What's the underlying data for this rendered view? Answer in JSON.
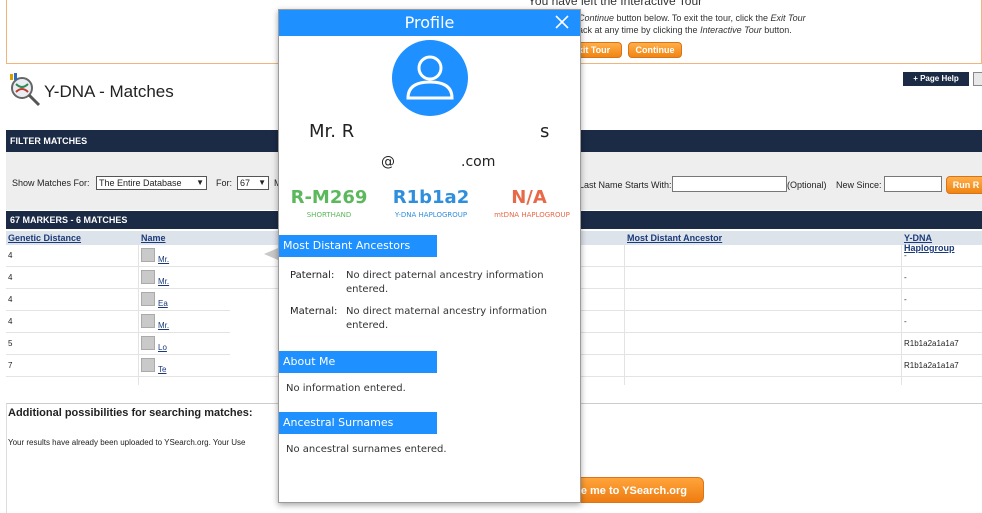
{
  "tour": {
    "title": "You have left the Interactive Tour",
    "line1_prefix": "",
    "line1_em": "Continue",
    "line1_rest": " button below. To exit the tour, click the ",
    "line1_em2": "Exit Tour",
    "line2_prefix": "ack at any time by clicking the ",
    "line2_em": "Interactive Tour",
    "line2_rest": " button.",
    "exit_label": "Exit Tour",
    "continue_label": "Continue"
  },
  "header": {
    "title": "Y-DNA - Matches",
    "page_help_label": "+ Page Help"
  },
  "filter": {
    "bar_title": "FILTER MATCHES",
    "show_for_label": "Show Matches For:",
    "show_for_value": "The Entire Database",
    "for_label": "For:",
    "for_value": "67",
    "for_more": "M",
    "last_name_label": "Last Name Starts With:",
    "optional": "(Optional)",
    "new_since_label": "New Since:",
    "run_label": "Run R"
  },
  "table": {
    "bar_title": "67 MARKERS - 6 MATCHES",
    "headers": {
      "distance": "Genetic Distance",
      "name": "Name",
      "ancestor": "Most Distant Ancestor",
      "haplogroup": "Y-DNA Haplogroup"
    },
    "rows": [
      {
        "distance": "4",
        "name": "Mr.",
        "haplogroup": "-"
      },
      {
        "distance": "4",
        "name": "Mr.",
        "haplogroup": "-"
      },
      {
        "distance": "4",
        "name": "Ea",
        "haplogroup": "-"
      },
      {
        "distance": "4",
        "name": "Mr.",
        "haplogroup": "-"
      },
      {
        "distance": "5",
        "name": "Lo",
        "haplogroup": "R1b1a2a1a1a7"
      },
      {
        "distance": "7",
        "name": "Te",
        "haplogroup": "R1b1a2a1a1a7"
      }
    ]
  },
  "additional": {
    "title": "Additional possibilities for searching matches:",
    "text": "Your results have already been uploaded to YSearch.org. Your Use",
    "ysearch_label": "ke me to YSearch.org"
  },
  "profile": {
    "title": "Profile",
    "name_start": "Mr. R",
    "name_end": "s",
    "email_start": "@",
    "email_end": ".com",
    "shorthand_value": "R-M269",
    "shorthand_label": "SHORTHAND",
    "ydna_value": "R1b1a2",
    "ydna_label": "Y-DNA HAPLOGROUP",
    "mtdna_value": "N/A",
    "mtdna_label": "mtDNA HAPLOGROUP",
    "ancestors_title": "Most Distant Ancestors",
    "paternal_label": "Paternal:",
    "paternal_value": "No direct paternal ancestry information entered.",
    "maternal_label": "Maternal:",
    "maternal_value": "No direct maternal ancestry information entered.",
    "about_title": "About Me",
    "about_value": "No information entered.",
    "surnames_title": "Ancestral Surnames",
    "surnames_value": "No ancestral surnames entered."
  },
  "colors": {
    "modal_accent": "#1e90ff",
    "shorthand": "#5cb85c",
    "ydna": "#2f8fdc",
    "mtdna": "#e8694a",
    "nav_dark": "#1b2a45",
    "orange": "#f08512"
  }
}
